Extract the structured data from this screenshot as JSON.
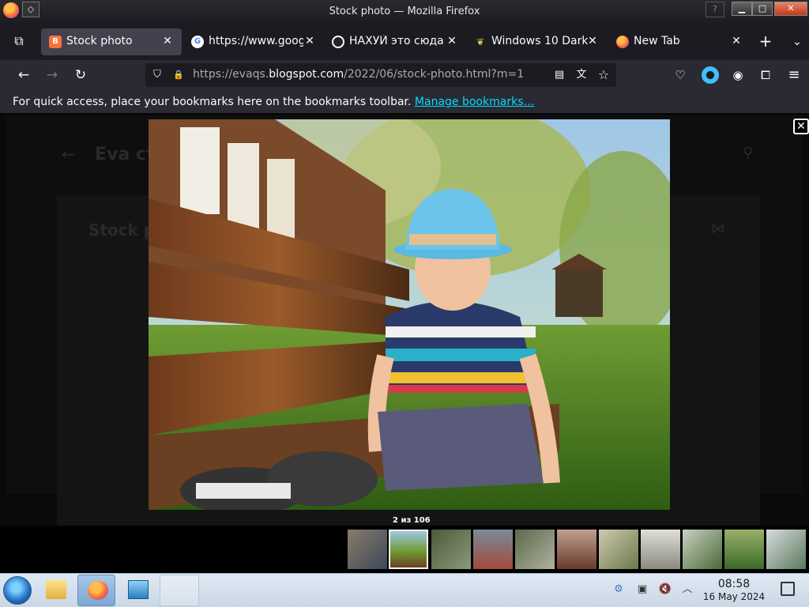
{
  "window": {
    "title": "Stock photo — Mozilla Firefox",
    "sys_menu_glyph": "◇",
    "help_glyph": "?",
    "min_glyph": "▁",
    "max_glyph": "□",
    "close_glyph": "✕"
  },
  "tabs": [
    {
      "label": "Stock photo",
      "favicon": "blogger-icon",
      "favicon_color": "#ff7139",
      "active": true
    },
    {
      "label": "https://www.google",
      "favicon": "google-icon",
      "favicon_color": "#ffffff",
      "active": false
    },
    {
      "label": "НАХУЙ это сюда",
      "favicon": "dark-circle-icon",
      "favicon_color": "#222222",
      "active": false
    },
    {
      "label": "Windows 10 Dark",
      "favicon": "leaf-icon",
      "favicon_color": "#e6c84a",
      "active": false
    },
    {
      "label": "New Tab",
      "favicon": "firefox-icon",
      "favicon_color": "#ff7139",
      "active": false
    }
  ],
  "tab_strip": {
    "tab_list_glyph": "⧉",
    "close_glyph": "✕",
    "new_tab_glyph": "+",
    "all_tabs_glyph": "⌄"
  },
  "navbar": {
    "back_glyph": "←",
    "forward_glyph": "→",
    "reload_glyph": "↻",
    "shield_glyph": "⛉",
    "lock_glyph": "🔒",
    "url_prefix": "https://evaqs.",
    "url_domain": "blogspot.com",
    "url_path": "/2022/06/stock-photo.html?m=1",
    "reader_glyph": "▤",
    "translate_glyph": "文",
    "bookmark_glyph": "☆",
    "pocket_glyph": "♡",
    "account_glyph": "◉",
    "extensions_glyph": "⧠",
    "menu_glyph": "≡"
  },
  "bookmarks_bar": {
    "text": "For quick access, place your bookmarks here on the bookmarks toolbar.",
    "link": "Manage bookmarks…"
  },
  "page_ghost": {
    "title": "Eva ст",
    "post_title": "Stock p",
    "back_glyph": "←",
    "search_glyph": "⚲",
    "share_glyph": "⋈"
  },
  "lightbox": {
    "close_glyph": "✕",
    "counter": "2 из 106",
    "thumb_count": 11,
    "active_thumb": 1
  },
  "taskbar": {
    "time": "08:58",
    "date": "16 May 2024",
    "tray_up_glyph": "︿",
    "mute_glyph": "🔇",
    "clipboard_glyph": "▣"
  },
  "colors": {
    "accent": "#00ddff",
    "tab_active": "#42414d",
    "toolbar": "#2b2a33"
  }
}
